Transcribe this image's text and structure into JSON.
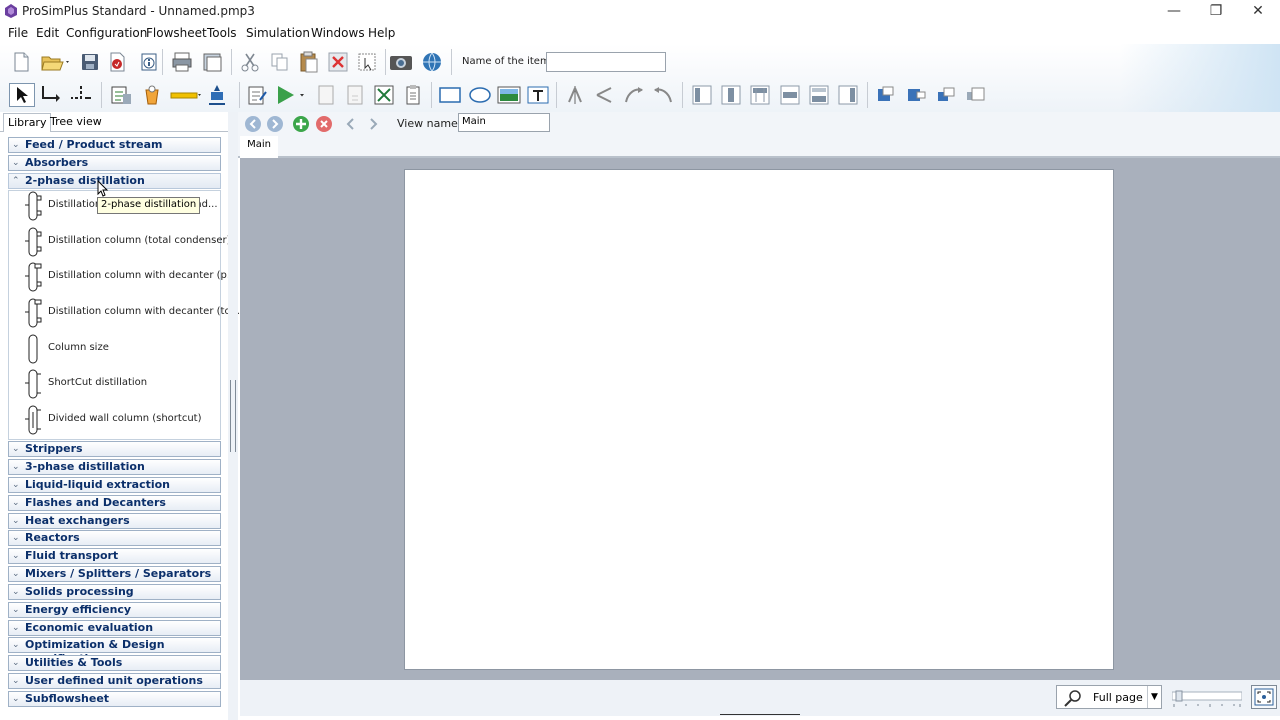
{
  "window": {
    "title": "ProSimPlus Standard - Unnamed.pmp3",
    "controls": [
      "minimize",
      "maximize",
      "close"
    ]
  },
  "menu": [
    "File",
    "Edit",
    "Configuration",
    "Flowsheet",
    "Tools",
    "Simulation",
    "Windows",
    "Help"
  ],
  "toolbar": {
    "name_label": "Name of the item:",
    "name_value": ""
  },
  "left_panel": {
    "tabs": [
      "Library",
      "Tree view"
    ],
    "categories": [
      "Feed / Product stream",
      "Absorbers",
      "2-phase distillation",
      "Strippers",
      "3-phase distillation",
      "Liquid-liquid extraction",
      "Flashes and Decanters",
      "Heat exchangers",
      "Reactors",
      "Fluid transport",
      "Mixers / Splitters / Separators",
      "Solids processing",
      "Energy efficiency",
      "Economic evaluation",
      "Optimization & Design specifications",
      "Utilities & Tools",
      "User defined unit operations",
      "Subflowsheet"
    ],
    "open_items": [
      "Distillation column (partial cond...",
      "Distillation column (total condenser)",
      "Distillation column with decanter (p...",
      "Distillation column with decanter (to...",
      "Column size",
      "ShortCut distillation",
      "Divided wall column (shortcut)"
    ],
    "tooltip": "2-phase distillation"
  },
  "view": {
    "name_label": "View name:",
    "name_value": "Main",
    "sheet_tab": "Main"
  },
  "status": {
    "zoom_mode": "Full page"
  }
}
